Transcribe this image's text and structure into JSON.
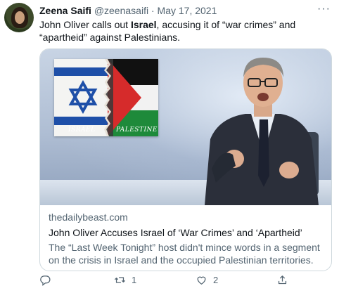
{
  "author": {
    "name": "Zeena Saifi",
    "handle": "@zeenasaifi",
    "separator": "·",
    "date": "May 17, 2021"
  },
  "more_label": "···",
  "tweet_text": {
    "part1": "John Oliver calls out ",
    "bold": "Israel",
    "part2": ", accusing it of “war crimes” and “apartheid” against Palestinians."
  },
  "card": {
    "image_labels": {
      "israel": "ISRAEL",
      "palestine": "PALESTINE"
    },
    "domain": "thedailybeast.com",
    "title": "John Oliver Accuses Israel of ‘War Crimes’ and ‘Apartheid’",
    "description": "The “Last Week Tonight” host didn't mince words in a segment on the crisis in Israel and the occupied Palestinian territories."
  },
  "actions": {
    "reply": {
      "icon": "reply-icon",
      "count": ""
    },
    "retweet": {
      "icon": "retweet-icon",
      "count": "1"
    },
    "like": {
      "icon": "heart-icon",
      "count": "2"
    },
    "share": {
      "icon": "share-icon",
      "count": ""
    }
  },
  "colors": {
    "text": "#0f1419",
    "secondary": "#536471",
    "border": "#cfd9de",
    "israel_blue": "#1e4fa8",
    "palestine_red": "#d62b2b",
    "palestine_green": "#1e8a3a"
  }
}
